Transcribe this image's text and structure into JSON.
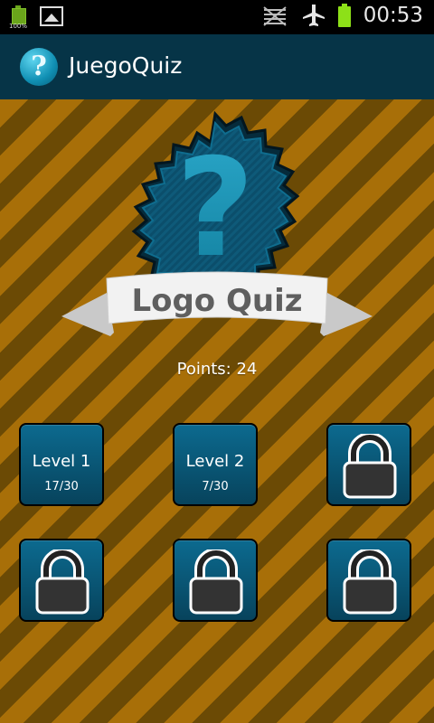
{
  "status_bar": {
    "battery_small_percent": "100%",
    "time": "00:53"
  },
  "app_bar": {
    "icon_glyph": "?",
    "title": "JuegoQuiz"
  },
  "logo": {
    "text": "Logo Quiz"
  },
  "points_label": "Points: 24",
  "levels": [
    {
      "name": "Level 1",
      "progress": "17/30",
      "locked": false
    },
    {
      "name": "Level 2",
      "progress": "7/30",
      "locked": false
    },
    {
      "locked": true
    },
    {
      "locked": true
    },
    {
      "locked": true
    },
    {
      "locked": true
    }
  ],
  "colors": {
    "app_bar_bg": "#063447",
    "stripe_light": "#a86f08",
    "stripe_dark": "#6b4a05",
    "tile_blue": "#0c6a8f"
  }
}
